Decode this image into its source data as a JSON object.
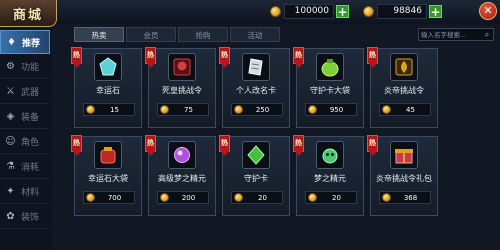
{
  "header": {
    "title": "商城",
    "currencies": [
      {
        "icon": "gold-coin-icon",
        "value": "100000"
      },
      {
        "icon": "gold-coin-icon",
        "value": "98846"
      }
    ],
    "close_icon": "close-icon"
  },
  "sidebar": {
    "items": [
      {
        "label": "推荐",
        "icon": "recommend-icon",
        "active": true
      },
      {
        "label": "功能",
        "icon": "function-icon",
        "active": false
      },
      {
        "label": "武器",
        "icon": "weapon-icon",
        "active": false
      },
      {
        "label": "装备",
        "icon": "equipment-icon",
        "active": false
      },
      {
        "label": "角色",
        "icon": "character-icon",
        "active": false
      },
      {
        "label": "消耗",
        "icon": "consumable-icon",
        "active": false
      },
      {
        "label": "材料",
        "icon": "material-icon",
        "active": false
      },
      {
        "label": "装饰",
        "icon": "decoration-icon",
        "active": false
      }
    ]
  },
  "tabs": [
    {
      "label": "热卖",
      "active": true
    },
    {
      "label": "会员",
      "active": false
    },
    {
      "label": "抢购",
      "active": false
    },
    {
      "label": "活动",
      "active": false
    }
  ],
  "search": {
    "placeholder": "输入名字搜索..."
  },
  "tag_text": "热",
  "items": [
    {
      "name": "幸运石",
      "price": "15",
      "icon": "lucky-stone-icon",
      "color": "#5ed0d6"
    },
    {
      "name": "死皇挑战令",
      "price": "75",
      "icon": "death-emperor-token-icon",
      "color": "#d04040"
    },
    {
      "name": "个人改名卡",
      "price": "250",
      "icon": "rename-card-icon",
      "color": "#d6dce4"
    },
    {
      "name": "守护卡大袋",
      "price": "950",
      "icon": "guardian-card-bag-icon",
      "color": "#7bd03a"
    },
    {
      "name": "炎帝挑战令",
      "price": "45",
      "icon": "flame-emperor-token-icon",
      "color": "#e0a020"
    },
    {
      "name": "幸运石大袋",
      "price": "700",
      "icon": "lucky-stone-bag-icon",
      "color": "#c02828"
    },
    {
      "name": "高级梦之精元",
      "price": "200",
      "icon": "advanced-dream-essence-icon",
      "color": "#b050e0"
    },
    {
      "name": "守护卡",
      "price": "20",
      "icon": "guardian-card-icon",
      "color": "#44c040"
    },
    {
      "name": "梦之精元",
      "price": "20",
      "icon": "dream-essence-icon",
      "color": "#4cc870"
    },
    {
      "name": "炎帝挑战令礼包",
      "price": "368",
      "icon": "flame-emperor-gift-pack-icon",
      "color": "#c83a4a"
    }
  ]
}
